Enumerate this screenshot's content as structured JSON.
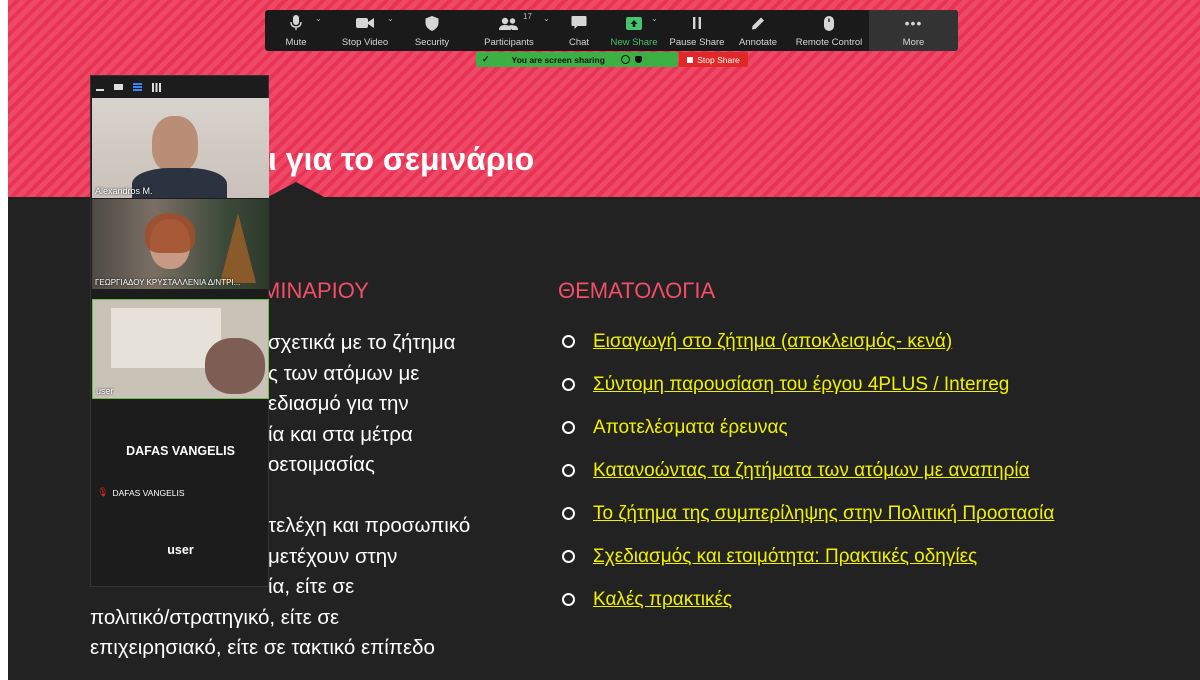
{
  "slide": {
    "title": "ι για το σεμινάριο",
    "left_heading": "ΜΙΝΑΡΙΟΥ",
    "right_heading": "ΘΕΜΑΤΟΛΟΓΙΑ",
    "left_lines": [
      "σχετικά με το ζήτημα",
      "ς των ατόμων με",
      "εδιασμό για την",
      "ία και στα μέτρα",
      "οετοιμασίας",
      "",
      "τελέχη και προσωπικό",
      "μετέχουν στην",
      "ία, είτε σε",
      "πολιτικό/στρατηγικό, είτε σε",
      "επιχειρησιακό, είτε σε τακτικό επίπεδο"
    ],
    "topics": [
      {
        "text": "Εισαγωγή στο ζήτημα (αποκλεισμός- κενά)",
        "link": true
      },
      {
        "text": "Σύντομη παρουσίαση του έργου 4PLUS / Interreg",
        "link": true
      },
      {
        "text": "Αποτελέσματα έρευνας",
        "link": false
      },
      {
        "text": "Κατανοώντας τα ζητήματα των ατόμων με αναπηρία",
        "link": true
      },
      {
        "text": "Το ζήτημα της συμπερίληψης στην Πολιτική Προστασία",
        "link": true
      },
      {
        "text": "Σχεδιασμός και ετοιμότητα: Πρακτικές οδηγίες",
        "link": true
      },
      {
        "text": "Καλές πρακτικές",
        "link": true
      }
    ]
  },
  "toolbar": {
    "mute": "Mute",
    "stop_video": "Stop Video",
    "security": "Security",
    "participants": "Participants",
    "participants_count": "17",
    "chat": "Chat",
    "new_share": "New Share",
    "pause_share": "Pause Share",
    "annotate": "Annotate",
    "remote_control": "Remote Control",
    "more": "More"
  },
  "share_status": {
    "text": "You are screen sharing",
    "stop_label": "Stop Share"
  },
  "participants": {
    "p1_name": "Alexandros M.",
    "p2_name": "ΓΕΩΡΓΙΑΔΟΥ ΚΡΥΣΤΑΛΛΕΝΙΑ Δ/ΝΤΡΙ...",
    "p3_name": "user",
    "p4_card": "DAFAS VANGELIS",
    "p4_name": "DAFAS VANGELIS",
    "p5_card": "user"
  },
  "colors": {
    "accent_pink": "#f24e68",
    "topic_yellow": "#f0f000",
    "share_green": "#3cb043",
    "stop_red": "#e02828"
  }
}
